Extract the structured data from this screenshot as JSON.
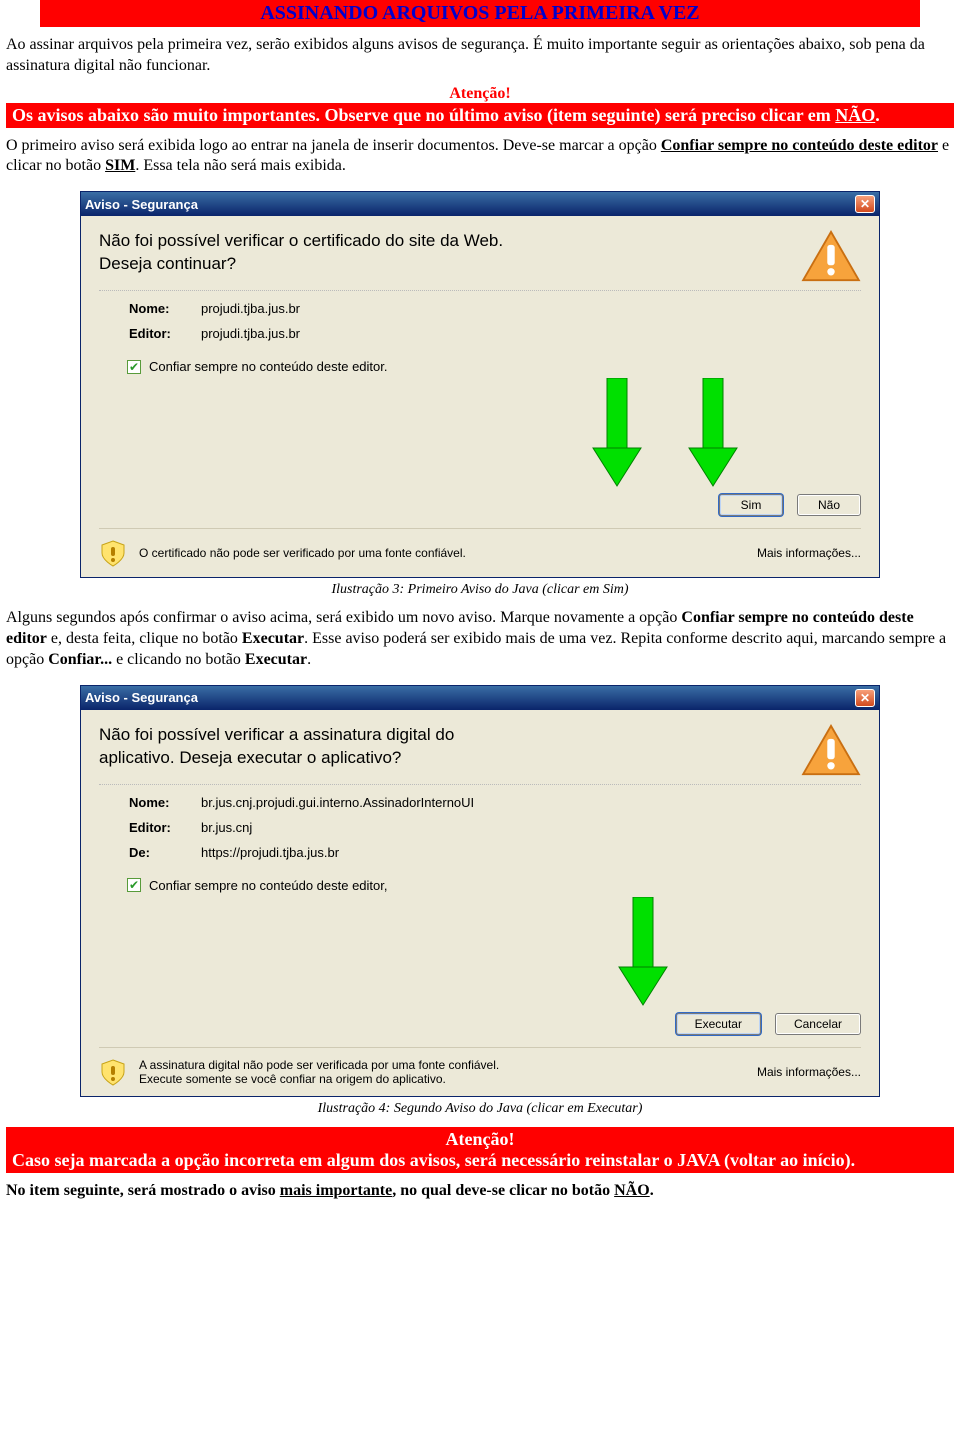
{
  "header": {
    "title": "ASSINANDO ARQUIVOS PELA PRIMEIRA VEZ"
  },
  "intro": {
    "p1": "Ao assinar arquivos pela primeira vez, serão exibidos alguns avisos de segurança. É muito importante seguir as orientações abaixo, sob pena da assinatura digital não funcionar."
  },
  "attention1": {
    "title": "Atenção!",
    "line_a": "Os avisos abaixo são muito importantes. Observe que no último aviso (item seguinte) será preciso clicar em ",
    "line_b": "NÃO",
    "line_c": "."
  },
  "para2": {
    "a": "O primeiro aviso será exibida logo ao entrar na janela de inserir documentos. Deve-se marcar a opção ",
    "b": "Confiar sempre no conteúdo deste editor",
    "c": " e clicar no botão ",
    "d": "SIM",
    "e": ". Essa tela não será mais exibida."
  },
  "dialog1": {
    "title": "Aviso - Segurança",
    "msg1": "Não foi possível verificar o certificado do site da Web.",
    "msg2": "Deseja continuar?",
    "nome_label": "Nome:",
    "nome_value": "projudi.tjba.jus.br",
    "editor_label": "Editor:",
    "editor_value": "projudi.tjba.jus.br",
    "check_label": "Confiar sempre no conteúdo deste editor.",
    "btn_yes": "Sim",
    "btn_no": "Não",
    "footer_text": "O certificado não pode ser verificado por uma fonte confiável.",
    "more_info": "Mais informações..."
  },
  "caption1": "Ilustração 3: Primeiro Aviso do Java (clicar em Sim)",
  "para3": {
    "a": "Alguns segundos após confirmar o aviso acima, será exibido um novo aviso. Marque novamente a opção ",
    "b": "Confiar sempre no conteúdo deste editor",
    "c": " e, desta feita, clique no botão ",
    "d": "Executar",
    "e": ". Esse aviso poderá ser exibido mais de uma vez. Repita conforme descrito aqui, marcando sempre a opção ",
    "f": "Confiar...",
    "g": " e clicando no botão ",
    "h": "Executar",
    "i": "."
  },
  "dialog2": {
    "title": "Aviso - Segurança",
    "msg1": "Não foi possível verificar a assinatura digital do",
    "msg2": "aplicativo. Deseja executar o aplicativo?",
    "nome_label": "Nome:",
    "nome_value": "br.jus.cnj.projudi.gui.interno.AssinadorInternoUI",
    "editor_label": "Editor:",
    "editor_value": "br.jus.cnj",
    "de_label": "De:",
    "de_value": "https://projudi.tjba.jus.br",
    "check_label": "Confiar sempre no conteúdo deste editor,",
    "btn_exec": "Executar",
    "btn_cancel": "Cancelar",
    "footer_text1": "A assinatura digital não pode ser verificada por uma fonte confiável.",
    "footer_text2": "Execute somente se você confiar na origem do aplicativo.",
    "more_info": "Mais informações..."
  },
  "caption2": "Ilustração 4: Segundo Aviso do Java (clicar em Executar)",
  "attention2": {
    "title": "Atenção!",
    "text": "Caso seja marcada a opção incorreta em algum dos avisos, será necessário reinstalar o JAVA (voltar ao início)."
  },
  "final": {
    "a": "No item seguinte, será mostrado o aviso ",
    "b": "mais importante",
    "c": ", no qual deve-se clicar no botão ",
    "d": "NÃO",
    "e": "."
  }
}
